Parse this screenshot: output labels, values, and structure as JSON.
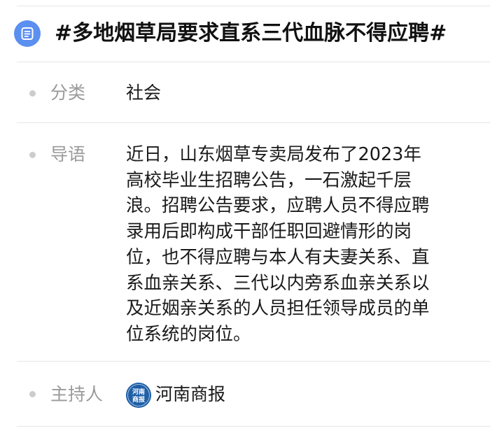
{
  "topic": {
    "title": "#多地烟草局要求直系三代血脉不得应聘#",
    "icon": "list-document-icon",
    "icon_color": "#5b8ff0"
  },
  "fields": {
    "category": {
      "label": "分类",
      "value": "社会"
    },
    "lead": {
      "label": "导语",
      "lines": [
        "近日，山东烟草专卖局发布了2023年",
        "高校毕业生招聘公告，一石激起千层",
        "浪。招聘公告要求，应聘人员不得应聘",
        "录用后即构成干部任职回避情形的岗",
        "位，也不得应聘与本人有夫妻关系、直",
        "系血亲关系、三代以内旁系血亲关系以",
        "及近姻亲关系的人员担任领导成员的单",
        "位系统的岗位。"
      ]
    },
    "host": {
      "label": "主持人",
      "avatar_text": "河南商报",
      "avatar_color": "#1f5fa8",
      "name": "河南商报"
    }
  }
}
